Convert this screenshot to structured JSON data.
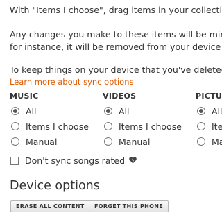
{
  "intro": {
    "line1": "With \"Items I choose\", drag items in your collectio",
    "line2": "Any changes you make to these items will be mirro",
    "line3": "for instance, it will be removed from your device as",
    "line4": "To keep things on your device that you've deleted",
    "link": "Learn more about sync options"
  },
  "sync": {
    "columns": [
      {
        "header": "MUSIC",
        "options": [
          "All",
          "Items I choose",
          "Manual"
        ],
        "selected": "All"
      },
      {
        "header": "VIDEOS",
        "options": [
          "All",
          "Items I choose",
          "Manual"
        ],
        "selected": "All"
      },
      {
        "header": "PICTUR",
        "options": [
          "All",
          "Ite",
          "Ma"
        ],
        "selected": "All"
      }
    ],
    "dont_sync_label": "Don't sync songs rated",
    "dont_sync_checked": false,
    "rating_icon": "broken-heart-icon"
  },
  "device_options": {
    "title": "Device options",
    "erase_label": "ERASE ALL CONTENT",
    "forget_label": "FORGET THIS PHONE"
  },
  "colors": {
    "link": "#e05a00",
    "text": "#333333"
  }
}
